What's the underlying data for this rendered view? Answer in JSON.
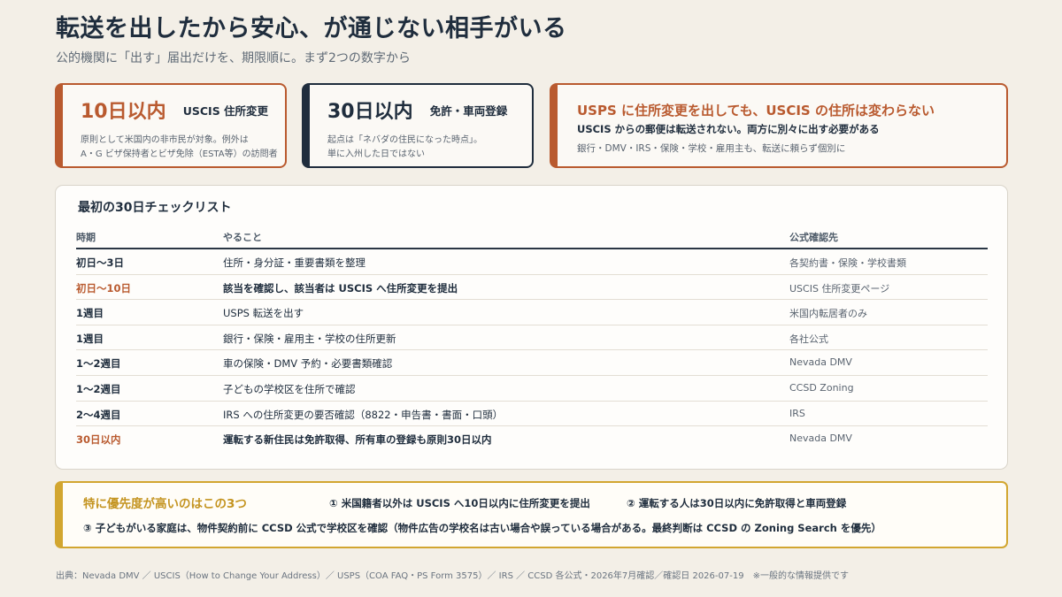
{
  "title": "転送を出したから安心、が通じない相手がいる",
  "subtitle": "公的機関に「出す」届出だけを、期限順に。まず2つの数字から",
  "cards": [
    {
      "big": "10日以内",
      "tag": "USCIS 住所変更",
      "note_line1": "原則として米国内の非市民が対象。例外は",
      "note_line2": "A・G ビザ保持者とビザ免除（ESTA等）の訪問者"
    },
    {
      "big": "30日以内",
      "tag": "免許・車両登録",
      "note_line1": "起点は「ネバダの住民になった時点」。",
      "note_line2": "単に入州した日ではない"
    }
  ],
  "warning": {
    "headline": "USPS に住所変更を出しても、USCIS の住所は変わらない",
    "sub": "USCIS からの郵便は転送されない。両方に別々に出す必要がある",
    "note": "銀行・DMV・IRS・保険・学校・雇用主も、転送に頼らず個別に"
  },
  "checklist": {
    "title": "最初の30日チェックリスト",
    "headers": [
      "時期",
      "やること",
      "公式確認先"
    ],
    "rows": [
      {
        "time": "初日〜3日",
        "task": "住所・身分証・重要書類を整理",
        "source": "各契約書・保険・学校書類",
        "highlight": false
      },
      {
        "time": "初日〜10日",
        "task": "該当を確認し、該当者は USCIS へ住所変更を提出",
        "source": "USCIS 住所変更ページ",
        "highlight": true
      },
      {
        "time": "1週目",
        "task": "USPS 転送を出す",
        "source": "米国内転居者のみ",
        "highlight": false
      },
      {
        "time": "1週目",
        "task": "銀行・保険・雇用主・学校の住所更新",
        "source": "各社公式",
        "highlight": false
      },
      {
        "time": "1〜2週目",
        "task": "車の保険・DMV 予約・必要書類確認",
        "source": "Nevada DMV",
        "highlight": false
      },
      {
        "time": "1〜2週目",
        "task": "子どもの学校区を住所で確認",
        "source": "CCSD Zoning",
        "highlight": false
      },
      {
        "time": "2〜4週目",
        "task": "IRS への住所変更の要否確認（8822・申告書・書面・口頭）",
        "source": "IRS",
        "highlight": false
      },
      {
        "time": "30日以内",
        "task": "運転する新住民は免許取得、所有車の登録も原則30日以内",
        "source": "Nevada DMV",
        "highlight": true
      }
    ]
  },
  "priority": {
    "title": "特に優先度が高いのはこの3つ",
    "item1": "① 米国籍者以外は USCIS へ10日以内に住所変更を提出",
    "item2": "② 運転する人は30日以内に免許取得と車両登録",
    "item3": "③ 子どもがいる家庭は、物件契約前に CCSD 公式で学校区を確認（物件広告の学校名は古い場合や誤っている場合がある。最終判断は CCSD の Zoning Search を優先）"
  },
  "footer": "出典：Nevada DMV ／ USCIS（How to Change Your Address）／ USPS（COA FAQ・PS Form 3575）／ IRS ／ CCSD 各公式・2026年7月確認／確認日 2026-07-19　※一般的な情報提供です",
  "colors": {
    "accent": "#b95a2f",
    "navy": "#1f2d3d",
    "gold": "#d2a630",
    "background": "#f3efe7"
  }
}
